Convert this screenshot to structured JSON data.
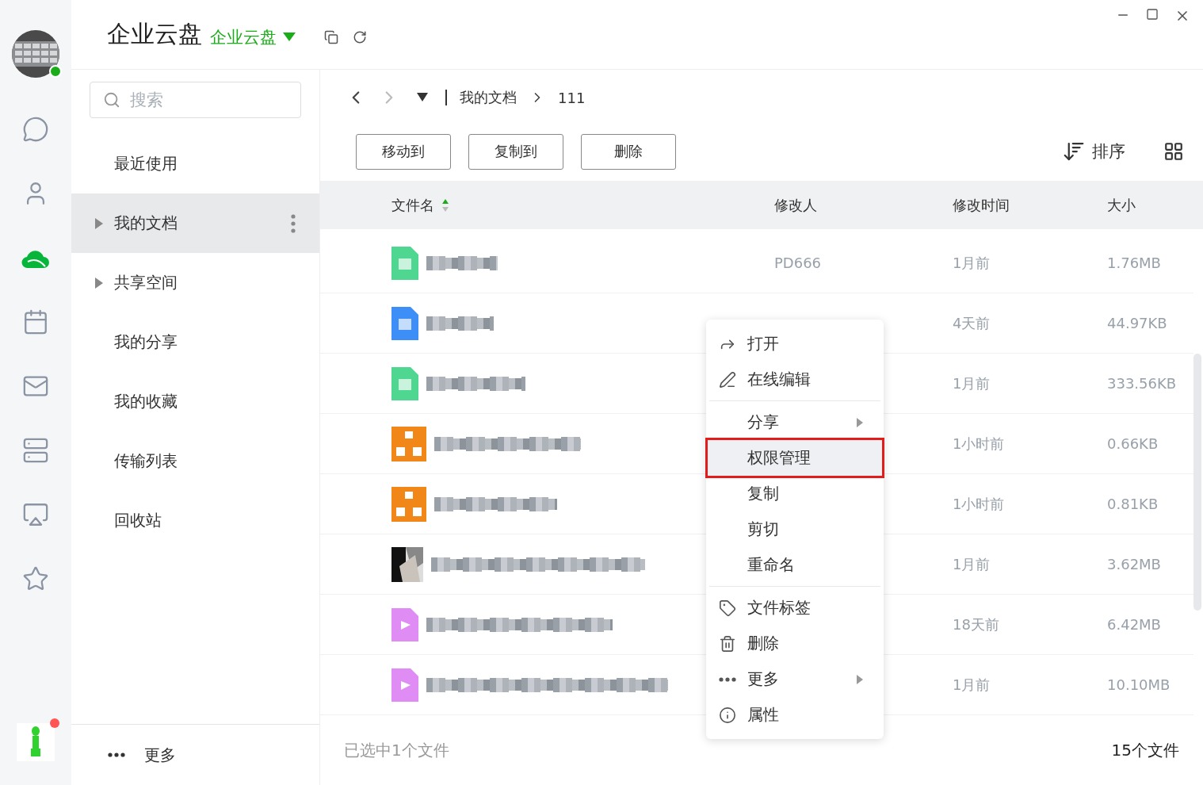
{
  "header": {
    "title": "企业云盘",
    "space_switcher": "企业云盘"
  },
  "user": {
    "online": true
  },
  "rail": [
    {
      "selected": false
    },
    {
      "selected": false
    },
    {
      "selected": true
    },
    {
      "selected": false
    },
    {
      "selected": false
    },
    {
      "selected": false
    },
    {
      "selected": false
    },
    {
      "selected": false
    }
  ],
  "bottom_app": {
    "notification": true
  },
  "search": {
    "placeholder": "搜索"
  },
  "sidebar": {
    "items": [
      {
        "label": "最近使用",
        "expandable": false,
        "selected": false
      },
      {
        "label": "我的文档",
        "expandable": true,
        "selected": true
      },
      {
        "label": "共享空间",
        "expandable": true,
        "selected": false
      },
      {
        "label": "我的分享",
        "expandable": false,
        "selected": false
      },
      {
        "label": "我的收藏",
        "expandable": false,
        "selected": false
      },
      {
        "label": "传输列表",
        "expandable": false,
        "selected": false
      },
      {
        "label": "回收站",
        "expandable": false,
        "selected": false
      }
    ],
    "more": "更多"
  },
  "breadcrumb": [
    "我的文档",
    "111"
  ],
  "toolbar": {
    "buttons": [
      "移动到",
      "复制到",
      "删除"
    ],
    "sort": "排序"
  },
  "table": {
    "columns": [
      {
        "label": "文件名",
        "sorted": true
      },
      {
        "label": "修改人",
        "sorted": false
      },
      {
        "label": "修改时间",
        "sorted": false
      },
      {
        "label": "大小",
        "sorted": false
      }
    ],
    "rows": [
      {
        "kind": "sheet",
        "modifier": "PD666",
        "time": "1月前",
        "size": "1.76MB"
      },
      {
        "kind": "doc",
        "time": "4天前",
        "size": "44.97KB"
      },
      {
        "kind": "sheet",
        "time": "1月前",
        "size": "333.56KB"
      },
      {
        "kind": "diagram",
        "time": "1小时前",
        "size": "0.66KB"
      },
      {
        "kind": "diagram",
        "time": "1小时前",
        "size": "0.81KB"
      },
      {
        "time": "1月前",
        "size": "3.62MB"
      },
      {
        "kind": "video",
        "time": "18天前",
        "size": "6.42MB"
      },
      {
        "kind": "video",
        "time": "1月前",
        "size": "10.10MB"
      }
    ]
  },
  "context_menu": {
    "groups": [
      [
        {
          "label": "打开",
          "kind": "open",
          "submenu": false,
          "selected": false
        },
        {
          "label": "在线编辑",
          "kind": "edit",
          "submenu": false,
          "selected": false
        }
      ],
      [
        {
          "label": "分享",
          "submenu": true,
          "selected": false
        },
        {
          "label": "权限管理",
          "submenu": false,
          "selected": true
        },
        {
          "label": "复制",
          "submenu": false,
          "selected": false
        },
        {
          "label": "剪切",
          "submenu": false,
          "selected": false
        },
        {
          "label": "重命名",
          "submenu": false,
          "selected": false
        }
      ],
      [
        {
          "label": "文件标签",
          "kind": "tag",
          "submenu": false,
          "selected": false
        },
        {
          "label": "删除",
          "kind": "trash",
          "submenu": false,
          "selected": false
        },
        {
          "label": "更多",
          "kind": "more",
          "submenu": true,
          "selected": false
        },
        {
          "label": "属性",
          "kind": "info",
          "submenu": false,
          "selected": false
        }
      ]
    ]
  },
  "status": {
    "selection": "已选中1个文件",
    "count": "15个文件"
  }
}
